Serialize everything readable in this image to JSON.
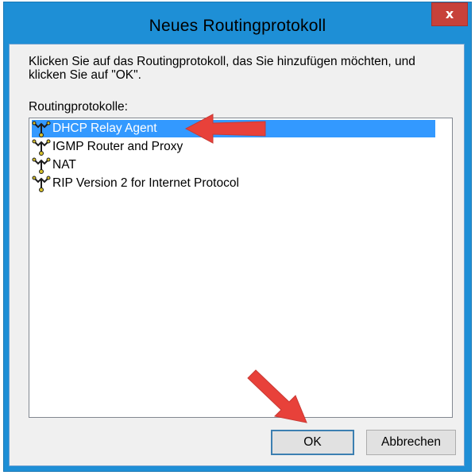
{
  "window": {
    "title": "Neues Routingprotokoll",
    "close_label": "x"
  },
  "dialog": {
    "instructions": "Klicken Sie auf das Routingprotokoll, das Sie hinzufügen möchten, und klicken Sie auf \"OK\".",
    "list_label": "Routingprotokolle:",
    "items": [
      {
        "label": "DHCP Relay Agent",
        "icon": "routing-protocol-icon",
        "selected": true
      },
      {
        "label": "IGMP Router and Proxy",
        "icon": "routing-protocol-icon",
        "selected": false
      },
      {
        "label": "NAT",
        "icon": "routing-protocol-icon",
        "selected": false
      },
      {
        "label": "RIP Version 2 for Internet Protocol",
        "icon": "routing-protocol-icon",
        "selected": false
      }
    ],
    "ok_label": "OK",
    "cancel_label": "Abbrechen"
  },
  "colors": {
    "window_frame": "#1e8fd6",
    "close_button": "#c7413a",
    "selection": "#3399ff",
    "annotation_arrow": "#e8413a"
  }
}
